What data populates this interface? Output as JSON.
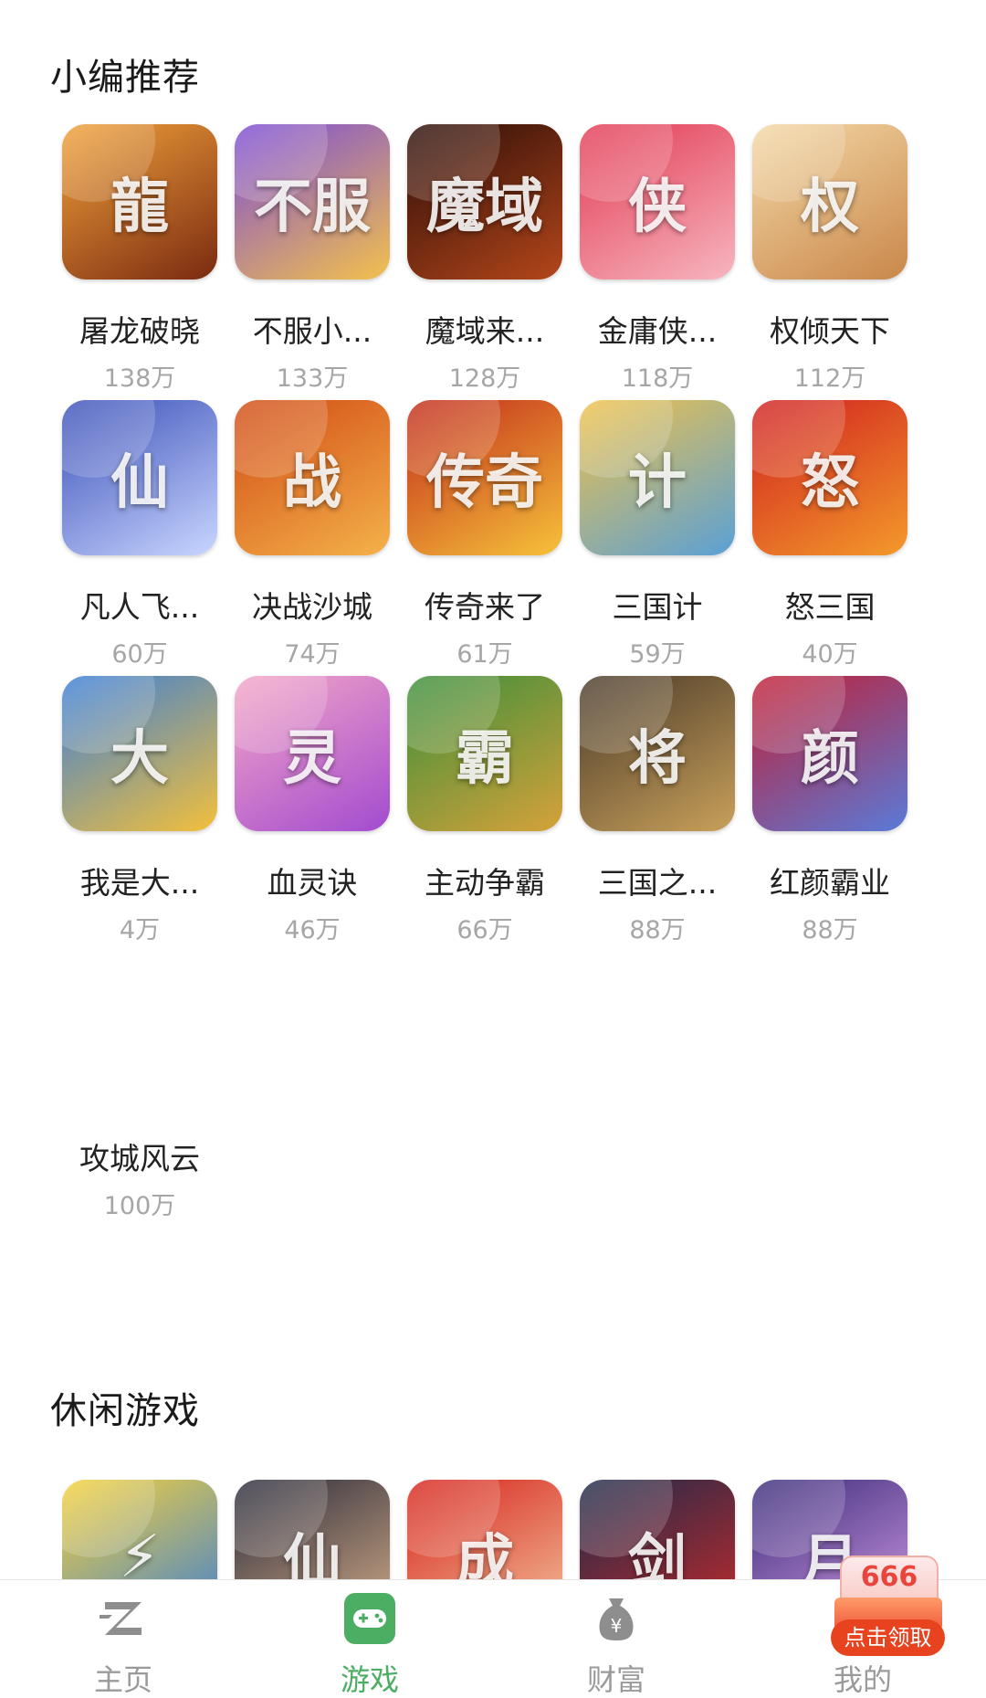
{
  "sections": {
    "recommended_title": "小编推荐",
    "casual_title": "休闲游戏"
  },
  "recommended": [
    {
      "name": "屠龙破晓",
      "count": "138万",
      "glyph": "龍",
      "colors": [
        "#f2a23a",
        "#7a2a10"
      ]
    },
    {
      "name": "不服小...",
      "count": "133万",
      "glyph": "不服",
      "colors": [
        "#7b4bd6",
        "#f3c14c"
      ]
    },
    {
      "name": "魔域来...",
      "count": "128万",
      "glyph": "魔域",
      "colors": [
        "#2a0d08",
        "#b4461a"
      ]
    },
    {
      "name": "金庸侠...",
      "count": "118万",
      "glyph": "侠",
      "colors": [
        "#e23a52",
        "#f7b6c0"
      ]
    },
    {
      "name": "权倾天下",
      "count": "112万",
      "glyph": "权",
      "colors": [
        "#f4d9a8",
        "#c9874a"
      ]
    },
    {
      "name": "凡人飞...",
      "count": "60万",
      "glyph": "仙",
      "colors": [
        "#3a4fb8",
        "#c9d6ff"
      ]
    },
    {
      "name": "决战沙城",
      "count": "74万",
      "glyph": "战",
      "colors": [
        "#d14a14",
        "#f4b24a"
      ]
    },
    {
      "name": "传奇来了",
      "count": "61万",
      "glyph": "传奇",
      "colors": [
        "#c22a1a",
        "#f6c23a"
      ]
    },
    {
      "name": "三国计",
      "count": "59万",
      "glyph": "计",
      "colors": [
        "#f0c24a",
        "#5aa0d6"
      ]
    },
    {
      "name": "怒三国",
      "count": "40万",
      "glyph": "怒",
      "colors": [
        "#d01f1f",
        "#f39a2a"
      ]
    },
    {
      "name": "我是大...",
      "count": "4万",
      "glyph": "大",
      "colors": [
        "#3a7ed8",
        "#f3c03a"
      ]
    },
    {
      "name": "血灵诀",
      "count": "46万",
      "glyph": "灵",
      "colors": [
        "#f5a7c6",
        "#a24bd0"
      ]
    },
    {
      "name": "主动争霸",
      "count": "66万",
      "glyph": "霸",
      "colors": [
        "#3a8e3a",
        "#d6a23a"
      ]
    },
    {
      "name": "三国之...",
      "count": "88万",
      "glyph": "将",
      "colors": [
        "#4a3a2a",
        "#c8a05a"
      ]
    },
    {
      "name": "红颜霸业",
      "count": "88万",
      "glyph": "颜",
      "colors": [
        "#c21e34",
        "#5a7ad8"
      ]
    },
    {
      "name": "攻城风云",
      "count": "100万",
      "glyph": "",
      "colors": [
        "#ffffff",
        "#ffffff"
      ]
    }
  ],
  "casual": [
    {
      "glyph": "⚡",
      "colors": [
        "#f7d23a",
        "#3a7ed8"
      ]
    },
    {
      "glyph": "仙",
      "colors": [
        "#2a2a3a",
        "#d8b08a"
      ]
    },
    {
      "glyph": "成",
      "colors": [
        "#d6221a",
        "#f4c8a0"
      ]
    },
    {
      "glyph": "剑",
      "colors": [
        "#1e2a4a",
        "#c82a2a"
      ]
    },
    {
      "glyph": "月",
      "colors": [
        "#3a2a7a",
        "#d8a0e8"
      ]
    }
  ],
  "nav": [
    {
      "label": "主页",
      "icon": "z-logo-icon",
      "active": false
    },
    {
      "label": "游戏",
      "icon": "gamepad-icon",
      "active": true
    },
    {
      "label": "财富",
      "icon": "money-bag-icon",
      "active": false
    },
    {
      "label": "我的",
      "icon": "user-icon",
      "active": false
    }
  ],
  "reward": {
    "amount": "666",
    "button_label": "点击领取"
  },
  "colors": {
    "accent": "#4cae63",
    "nav_inactive": "#9a9a9a",
    "reward_red": "#e8431f"
  }
}
